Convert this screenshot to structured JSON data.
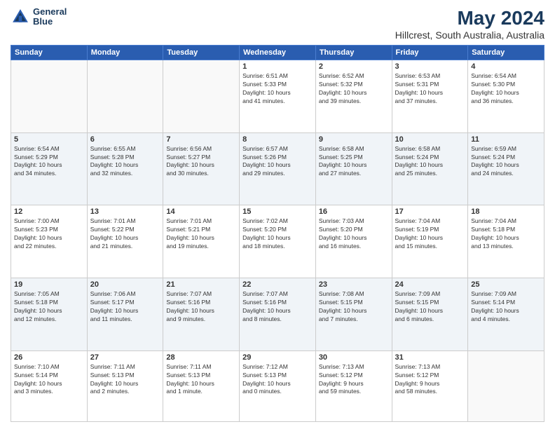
{
  "header": {
    "logo_line1": "General",
    "logo_line2": "Blue",
    "title": "May 2024",
    "subtitle": "Hillcrest, South Australia, Australia"
  },
  "days_of_week": [
    "Sunday",
    "Monday",
    "Tuesday",
    "Wednesday",
    "Thursday",
    "Friday",
    "Saturday"
  ],
  "weeks": [
    {
      "days": [
        {
          "num": "",
          "info": ""
        },
        {
          "num": "",
          "info": ""
        },
        {
          "num": "",
          "info": ""
        },
        {
          "num": "1",
          "info": "Sunrise: 6:51 AM\nSunset: 5:33 PM\nDaylight: 10 hours\nand 41 minutes."
        },
        {
          "num": "2",
          "info": "Sunrise: 6:52 AM\nSunset: 5:32 PM\nDaylight: 10 hours\nand 39 minutes."
        },
        {
          "num": "3",
          "info": "Sunrise: 6:53 AM\nSunset: 5:31 PM\nDaylight: 10 hours\nand 37 minutes."
        },
        {
          "num": "4",
          "info": "Sunrise: 6:54 AM\nSunset: 5:30 PM\nDaylight: 10 hours\nand 36 minutes."
        }
      ],
      "alt": false
    },
    {
      "days": [
        {
          "num": "5",
          "info": "Sunrise: 6:54 AM\nSunset: 5:29 PM\nDaylight: 10 hours\nand 34 minutes."
        },
        {
          "num": "6",
          "info": "Sunrise: 6:55 AM\nSunset: 5:28 PM\nDaylight: 10 hours\nand 32 minutes."
        },
        {
          "num": "7",
          "info": "Sunrise: 6:56 AM\nSunset: 5:27 PM\nDaylight: 10 hours\nand 30 minutes."
        },
        {
          "num": "8",
          "info": "Sunrise: 6:57 AM\nSunset: 5:26 PM\nDaylight: 10 hours\nand 29 minutes."
        },
        {
          "num": "9",
          "info": "Sunrise: 6:58 AM\nSunset: 5:25 PM\nDaylight: 10 hours\nand 27 minutes."
        },
        {
          "num": "10",
          "info": "Sunrise: 6:58 AM\nSunset: 5:24 PM\nDaylight: 10 hours\nand 25 minutes."
        },
        {
          "num": "11",
          "info": "Sunrise: 6:59 AM\nSunset: 5:24 PM\nDaylight: 10 hours\nand 24 minutes."
        }
      ],
      "alt": true
    },
    {
      "days": [
        {
          "num": "12",
          "info": "Sunrise: 7:00 AM\nSunset: 5:23 PM\nDaylight: 10 hours\nand 22 minutes."
        },
        {
          "num": "13",
          "info": "Sunrise: 7:01 AM\nSunset: 5:22 PM\nDaylight: 10 hours\nand 21 minutes."
        },
        {
          "num": "14",
          "info": "Sunrise: 7:01 AM\nSunset: 5:21 PM\nDaylight: 10 hours\nand 19 minutes."
        },
        {
          "num": "15",
          "info": "Sunrise: 7:02 AM\nSunset: 5:20 PM\nDaylight: 10 hours\nand 18 minutes."
        },
        {
          "num": "16",
          "info": "Sunrise: 7:03 AM\nSunset: 5:20 PM\nDaylight: 10 hours\nand 16 minutes."
        },
        {
          "num": "17",
          "info": "Sunrise: 7:04 AM\nSunset: 5:19 PM\nDaylight: 10 hours\nand 15 minutes."
        },
        {
          "num": "18",
          "info": "Sunrise: 7:04 AM\nSunset: 5:18 PM\nDaylight: 10 hours\nand 13 minutes."
        }
      ],
      "alt": false
    },
    {
      "days": [
        {
          "num": "19",
          "info": "Sunrise: 7:05 AM\nSunset: 5:18 PM\nDaylight: 10 hours\nand 12 minutes."
        },
        {
          "num": "20",
          "info": "Sunrise: 7:06 AM\nSunset: 5:17 PM\nDaylight: 10 hours\nand 11 minutes."
        },
        {
          "num": "21",
          "info": "Sunrise: 7:07 AM\nSunset: 5:16 PM\nDaylight: 10 hours\nand 9 minutes."
        },
        {
          "num": "22",
          "info": "Sunrise: 7:07 AM\nSunset: 5:16 PM\nDaylight: 10 hours\nand 8 minutes."
        },
        {
          "num": "23",
          "info": "Sunrise: 7:08 AM\nSunset: 5:15 PM\nDaylight: 10 hours\nand 7 minutes."
        },
        {
          "num": "24",
          "info": "Sunrise: 7:09 AM\nSunset: 5:15 PM\nDaylight: 10 hours\nand 6 minutes."
        },
        {
          "num": "25",
          "info": "Sunrise: 7:09 AM\nSunset: 5:14 PM\nDaylight: 10 hours\nand 4 minutes."
        }
      ],
      "alt": true
    },
    {
      "days": [
        {
          "num": "26",
          "info": "Sunrise: 7:10 AM\nSunset: 5:14 PM\nDaylight: 10 hours\nand 3 minutes."
        },
        {
          "num": "27",
          "info": "Sunrise: 7:11 AM\nSunset: 5:13 PM\nDaylight: 10 hours\nand 2 minutes."
        },
        {
          "num": "28",
          "info": "Sunrise: 7:11 AM\nSunset: 5:13 PM\nDaylight: 10 hours\nand 1 minute."
        },
        {
          "num": "29",
          "info": "Sunrise: 7:12 AM\nSunset: 5:13 PM\nDaylight: 10 hours\nand 0 minutes."
        },
        {
          "num": "30",
          "info": "Sunrise: 7:13 AM\nSunset: 5:12 PM\nDaylight: 9 hours\nand 59 minutes."
        },
        {
          "num": "31",
          "info": "Sunrise: 7:13 AM\nSunset: 5:12 PM\nDaylight: 9 hours\nand 58 minutes."
        },
        {
          "num": "",
          "info": ""
        }
      ],
      "alt": false
    }
  ]
}
